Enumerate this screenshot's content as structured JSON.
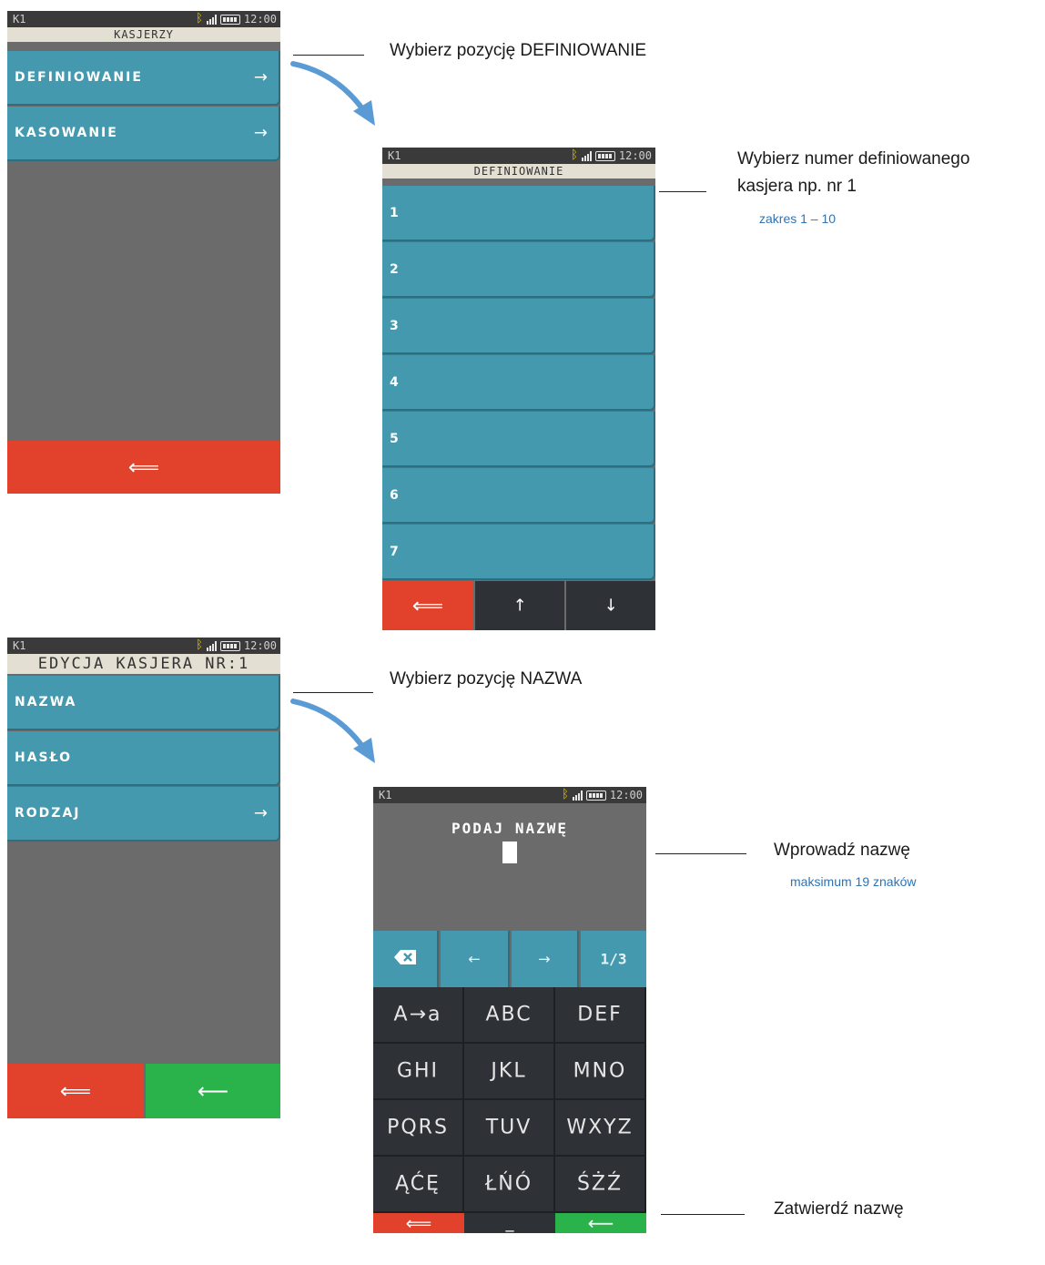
{
  "status": {
    "terminal": "K1",
    "time": "12:00"
  },
  "screen1": {
    "title": "KASJERZY",
    "items": [
      {
        "label": "DEFINIOWANIE",
        "arrow": "→"
      },
      {
        "label": "KASOWANIE",
        "arrow": "→"
      }
    ],
    "back": "⟸"
  },
  "screen2": {
    "title": "DEFINIOWANIE",
    "items": [
      "1",
      "2",
      "3",
      "4",
      "5",
      "6",
      "7"
    ],
    "back": "⟸",
    "up": "↑",
    "down": "↓"
  },
  "screen3": {
    "title": "EDYCJA KASJERA NR:1",
    "items": [
      {
        "label": "NAZWA",
        "arrow": ""
      },
      {
        "label": "HASŁO",
        "arrow": ""
      },
      {
        "label": "RODZAJ",
        "arrow": "→"
      }
    ],
    "back": "⟸",
    "enter": "⟵"
  },
  "screen4": {
    "prompt": "PODAJ NAZWĘ",
    "controls": {
      "left": "←",
      "right": "→",
      "page": "1/3"
    },
    "keys": [
      "A→a",
      "ABC",
      "DEF",
      "GHI",
      "JKL",
      "MNO",
      "PQRS",
      "TUV",
      "WXYZ",
      "ĄĆĘ",
      "ŁŃÓ",
      "ŚŻŹ"
    ],
    "back": "⟸",
    "space": "_",
    "enter": "⟵"
  },
  "annotations": {
    "a1": "Wybierz pozycję DEFINIOWANIE",
    "a2_line1": "Wybierz numer definiowanego",
    "a2_line2": "kasjera np. nr 1",
    "a2_note": "zakres 1 – 10",
    "a3": "Wybierz pozycję NAZWA",
    "a4": "Wprowadź nazwę",
    "a4_note": "maksimum 19 znaków",
    "a5": "Zatwierdź nazwę"
  },
  "colors": {
    "menu": "#4499ae",
    "red": "#e2412b",
    "green": "#2ab24b",
    "dark": "#2e3236",
    "background": "#6b6b6b",
    "arrow": "#5b9bd5"
  }
}
